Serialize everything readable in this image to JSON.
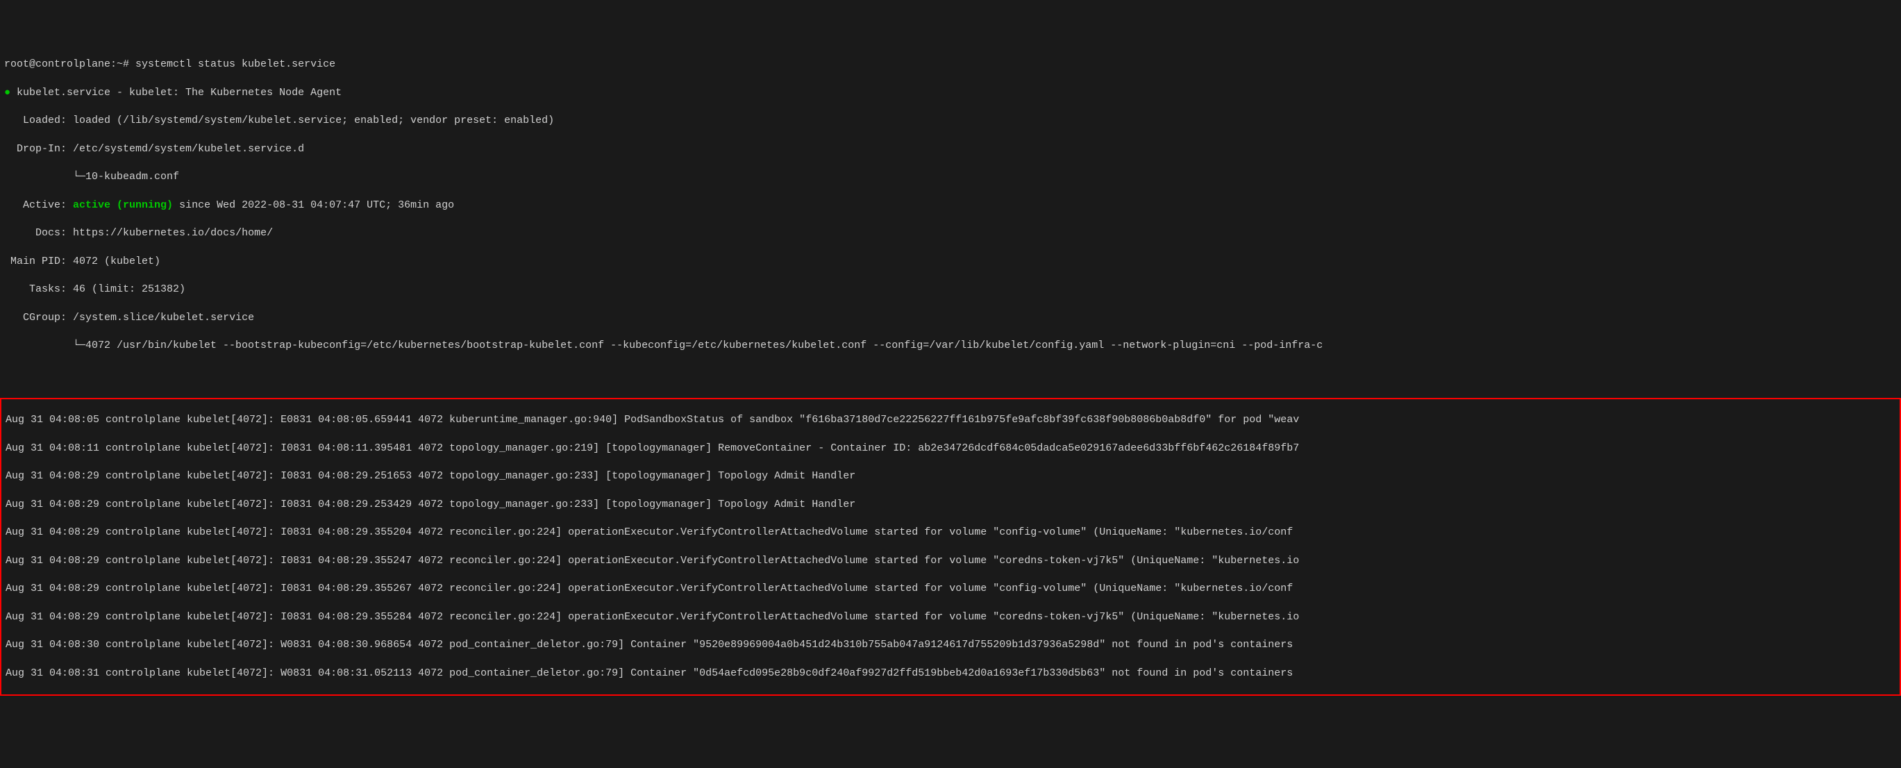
{
  "prompt": {
    "text": "root@controlplane:~# systemctl status kubelet.service"
  },
  "status": {
    "bullet": "●",
    "service_line": " kubelet.service - kubelet: The Kubernetes Node Agent",
    "loaded_label": "   Loaded: ",
    "loaded_value": "loaded (/lib/systemd/system/kubelet.service; enabled; vendor preset: enabled)",
    "dropin_label": "  Drop-In: ",
    "dropin_value": "/etc/systemd/system/kubelet.service.d",
    "dropin_conf": "           └─10-kubeadm.conf",
    "active_label": "   Active: ",
    "active_state": "active (running)",
    "active_since": " since Wed 2022-08-31 04:07:47 UTC; 36min ago",
    "docs_label": "     Docs: ",
    "docs_value": "https://kubernetes.io/docs/home/",
    "mainpid_label": " Main PID: ",
    "mainpid_value": "4072 (kubelet)",
    "tasks_label": "    Tasks: ",
    "tasks_value": "46 (limit: 251382)",
    "cgroup_label": "   CGroup: ",
    "cgroup_value": "/system.slice/kubelet.service",
    "cgroup_cmd": "           └─4072 /usr/bin/kubelet --bootstrap-kubeconfig=/etc/kubernetes/bootstrap-kubelet.conf --kubeconfig=/etc/kubernetes/kubelet.conf --config=/var/lib/kubelet/config.yaml --network-plugin=cni --pod-infra-c"
  },
  "logs": [
    "Aug 31 04:08:05 controlplane kubelet[4072]: E0831 04:08:05.659441    4072 kuberuntime_manager.go:940] PodSandboxStatus of sandbox \"f616ba37180d7ce22256227ff161b975fe9afc8bf39fc638f90b8086b0ab8df0\" for pod \"weav",
    "Aug 31 04:08:11 controlplane kubelet[4072]: I0831 04:08:11.395481    4072 topology_manager.go:219] [topologymanager] RemoveContainer - Container ID: ab2e34726dcdf684c05dadca5e029167adee6d33bff6bf462c26184f89fb7",
    "Aug 31 04:08:29 controlplane kubelet[4072]: I0831 04:08:29.251653    4072 topology_manager.go:233] [topologymanager] Topology Admit Handler",
    "Aug 31 04:08:29 controlplane kubelet[4072]: I0831 04:08:29.253429    4072 topology_manager.go:233] [topologymanager] Topology Admit Handler",
    "Aug 31 04:08:29 controlplane kubelet[4072]: I0831 04:08:29.355204    4072 reconciler.go:224] operationExecutor.VerifyControllerAttachedVolume started for volume \"config-volume\" (UniqueName: \"kubernetes.io/conf",
    "Aug 31 04:08:29 controlplane kubelet[4072]: I0831 04:08:29.355247    4072 reconciler.go:224] operationExecutor.VerifyControllerAttachedVolume started for volume \"coredns-token-vj7k5\" (UniqueName: \"kubernetes.io",
    "Aug 31 04:08:29 controlplane kubelet[4072]: I0831 04:08:29.355267    4072 reconciler.go:224] operationExecutor.VerifyControllerAttachedVolume started for volume \"config-volume\" (UniqueName: \"kubernetes.io/conf",
    "Aug 31 04:08:29 controlplane kubelet[4072]: I0831 04:08:29.355284    4072 reconciler.go:224] operationExecutor.VerifyControllerAttachedVolume started for volume \"coredns-token-vj7k5\" (UniqueName: \"kubernetes.io",
    "Aug 31 04:08:30 controlplane kubelet[4072]: W0831 04:08:30.968654    4072 pod_container_deletor.go:79] Container \"9520e89969004a0b451d24b310b755ab047a9124617d755209b1d37936a5298d\" not found in pod's containers",
    "Aug 31 04:08:31 controlplane kubelet[4072]: W0831 04:08:31.052113    4072 pod_container_deletor.go:79] Container \"0d54aefcd095e28b9c0df240af9927d2ffd519bbeb42d0a1693ef17b330d5b63\" not found in pod's containers"
  ]
}
